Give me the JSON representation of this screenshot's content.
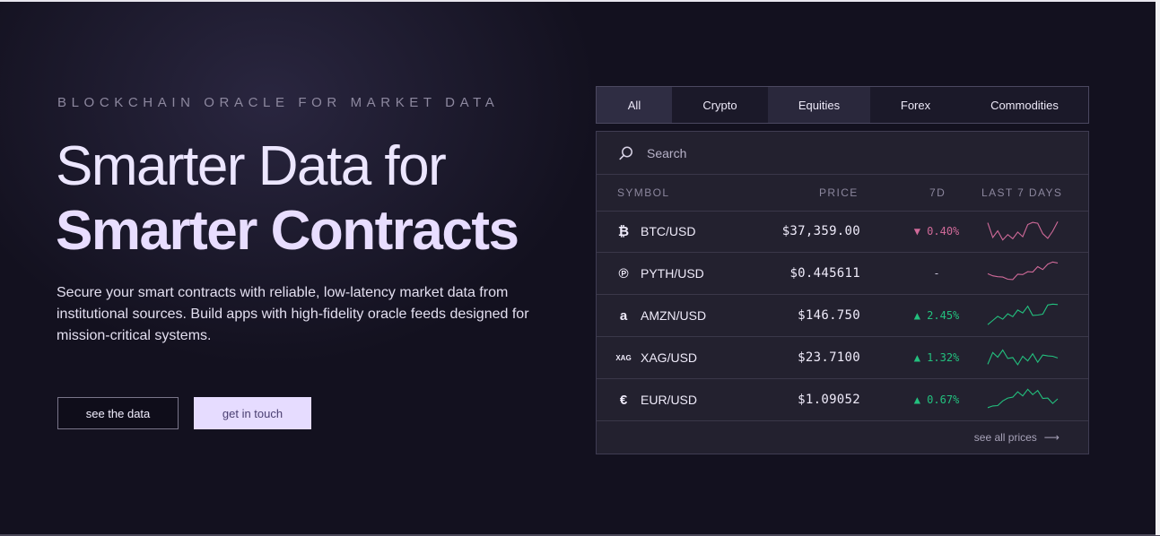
{
  "hero": {
    "eyebrow": "BLOCKCHAIN ORACLE FOR MARKET DATA",
    "headline_line1": "Smarter Data for",
    "headline_line2": "Smarter Contracts",
    "description": "Secure your smart contracts with reliable, low-latency market data from institutional sources. Build apps with high-fidelity oracle feeds designed for mission-critical systems.",
    "btn_see_data": "see the data",
    "btn_get_in_touch": "get in touch"
  },
  "tabs": [
    {
      "label": "All",
      "active": true
    },
    {
      "label": "Crypto",
      "active": false
    },
    {
      "label": "Equities",
      "active": false
    },
    {
      "label": "Forex",
      "active": false
    },
    {
      "label": "Commodities",
      "active": false
    }
  ],
  "search": {
    "placeholder": "Search",
    "icon": "search-icon"
  },
  "table": {
    "headers": {
      "symbol": "SYMBOL",
      "price": "PRICE",
      "change": "7D",
      "last7": "LAST 7 DAYS"
    },
    "rows": [
      {
        "icon": "bitcoin-icon",
        "icon_glyph": "₿",
        "symbol": "BTC/USD",
        "price": "$37,359.00",
        "change": "0.40%",
        "direction": "down",
        "spark": [
          0.2,
          0.75,
          0.55,
          0.85,
          0.7,
          0.8,
          0.6,
          0.72,
          0.3,
          0.15,
          0.25,
          0.6,
          0.85,
          0.5,
          0.15
        ]
      },
      {
        "icon": "pyth-icon",
        "icon_glyph": "℗",
        "symbol": "PYTH/USD",
        "price": "$0.445611",
        "change": "-",
        "direction": "flat",
        "spark": [
          0.55,
          0.6,
          0.7,
          0.65,
          0.8,
          0.75,
          0.6,
          0.55,
          0.5,
          0.45,
          0.3,
          0.35,
          0.2,
          0.05,
          0.12
        ]
      },
      {
        "icon": "amazon-icon",
        "icon_glyph": "a",
        "symbol": "AMZN/USD",
        "price": "$146.750",
        "change": "2.45%",
        "direction": "up",
        "spark": [
          0.9,
          0.7,
          0.6,
          0.65,
          0.5,
          0.55,
          0.35,
          0.4,
          0.2,
          0.5,
          0.55,
          0.45,
          0.15,
          0.05,
          0.1
        ]
      },
      {
        "icon": "xag-icon",
        "icon_glyph": "XAG",
        "symbol": "XAG/USD",
        "price": "$23.7100",
        "change": "1.32%",
        "direction": "up",
        "spark": [
          0.8,
          0.3,
          0.55,
          0.2,
          0.6,
          0.5,
          0.85,
          0.45,
          0.7,
          0.35,
          0.75,
          0.4,
          0.5,
          0.45,
          0.55
        ]
      },
      {
        "icon": "euro-icon",
        "icon_glyph": "€",
        "symbol": "EUR/USD",
        "price": "$1.09052",
        "change": "0.67%",
        "direction": "up",
        "spark": [
          0.85,
          0.75,
          0.8,
          0.55,
          0.5,
          0.4,
          0.25,
          0.35,
          0.15,
          0.3,
          0.2,
          0.45,
          0.5,
          0.65,
          0.5
        ]
      }
    ]
  },
  "see_all": {
    "label": "see all prices",
    "arrow": "⟶"
  },
  "colors": {
    "background": "#13111f",
    "accent": "#e6dcff",
    "up": "#23c07e",
    "down": "#d06a99"
  }
}
